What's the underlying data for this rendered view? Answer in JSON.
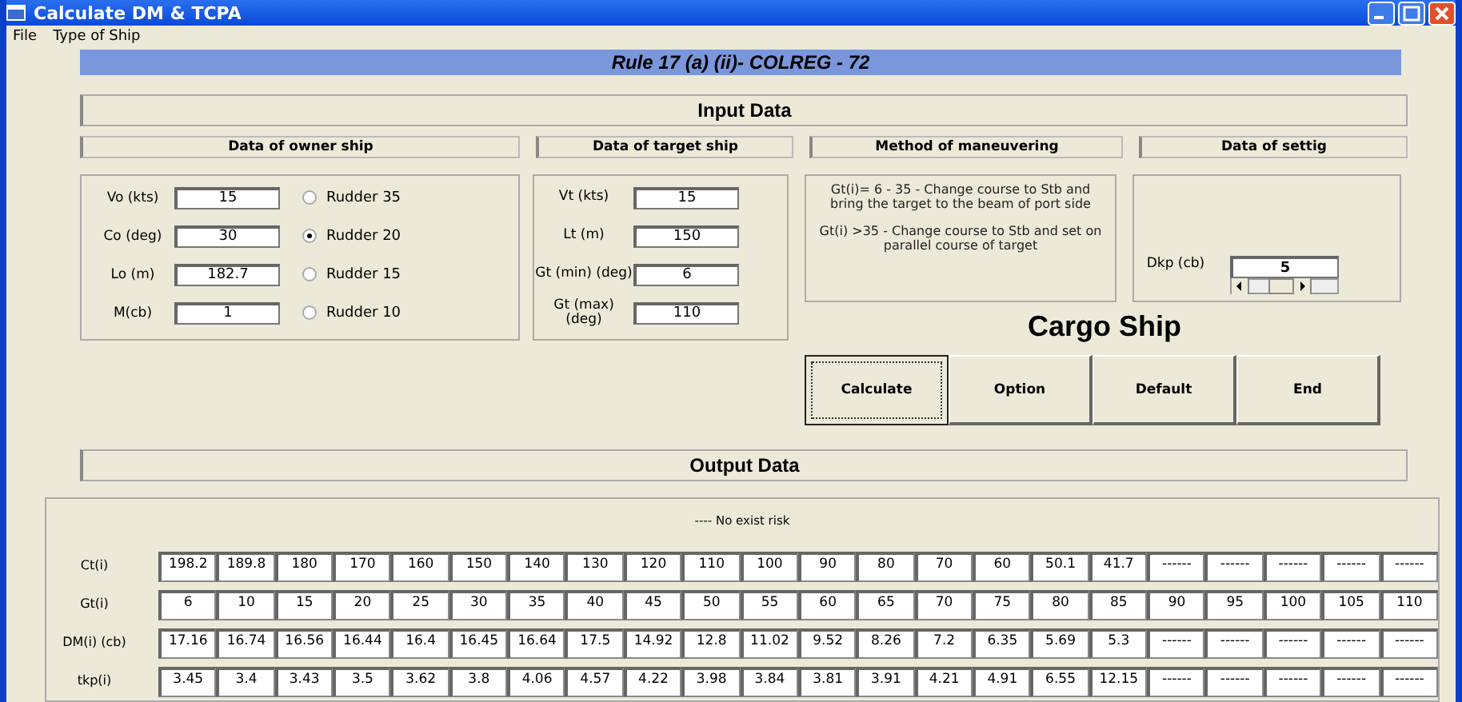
{
  "window": {
    "title": "Calculate DM & TCPA"
  },
  "menu": [
    "File",
    "Type of Ship"
  ],
  "banner": "Rule 17 (a) (ii)- COLREG - 72",
  "input_title": "Input Data",
  "section_headers": [
    "Data of owner ship",
    "Data of target ship",
    "Method of maneuvering",
    "Data of settig"
  ],
  "owner_fields": [
    {
      "label": "Vo (kts)",
      "value": "15"
    },
    {
      "label": "Co (deg)",
      "value": "30"
    },
    {
      "label": "Lo (m)",
      "value": "182.7"
    },
    {
      "label": "M(cb)",
      "value": "1"
    }
  ],
  "rudder_options": [
    {
      "label": "Rudder 35",
      "selected": false
    },
    {
      "label": "Rudder 20",
      "selected": true
    },
    {
      "label": "Rudder 15",
      "selected": false
    },
    {
      "label": "Rudder 10",
      "selected": false
    }
  ],
  "target_fields": [
    {
      "label": "Vt (kts)",
      "value": "15"
    },
    {
      "label": "Lt (m)",
      "value": "150"
    },
    {
      "label": "Gt (min) (deg)",
      "value": "6"
    },
    {
      "label": "Gt (max) (deg)",
      "value": "110"
    }
  ],
  "method_text": [
    "Gt(i)= 6 - 35 - Change course to Stb and bring the target to the beam of port side",
    "Gt(i) >35 - Change course to Stb and set on parallel course of target"
  ],
  "setting": {
    "label": "Dkp (cb)",
    "value": "5"
  },
  "ship_type": "Cargo Ship",
  "buttons": [
    {
      "label": "Calculate",
      "focused": true
    },
    {
      "label": "Option",
      "focused": false
    },
    {
      "label": "Default",
      "focused": false
    },
    {
      "label": "End",
      "focused": false
    }
  ],
  "output_title": "Output Data",
  "status_note": "---- No exist risk",
  "output_rows": [
    {
      "label": "Ct(i)",
      "cells": [
        "198.2",
        "189.8",
        "180",
        "170",
        "160",
        "150",
        "140",
        "130",
        "120",
        "110",
        "100",
        "90",
        "80",
        "70",
        "60",
        "50.1",
        "41.7",
        "------",
        "------",
        "------",
        "------",
        "------"
      ]
    },
    {
      "label": "Gt(i)",
      "cells": [
        "6",
        "10",
        "15",
        "20",
        "25",
        "30",
        "35",
        "40",
        "45",
        "50",
        "55",
        "60",
        "65",
        "70",
        "75",
        "80",
        "85",
        "90",
        "95",
        "100",
        "105",
        "110"
      ]
    },
    {
      "label": "DM(i) (cb)",
      "cells": [
        "17.16",
        "16.74",
        "16.56",
        "16.44",
        "16.4",
        "16.45",
        "16.64",
        "17.5",
        "14.92",
        "12.8",
        "11.02",
        "9.52",
        "8.26",
        "7.2",
        "6.35",
        "5.69",
        "5.3",
        "------",
        "------",
        "------",
        "------",
        "------"
      ]
    },
    {
      "label": "tkp(i)",
      "cells": [
        "3.45",
        "3.4",
        "3.43",
        "3.5",
        "3.62",
        "3.8",
        "4.06",
        "4.57",
        "4.22",
        "3.98",
        "3.84",
        "3.81",
        "3.91",
        "4.21",
        "4.91",
        "6.55",
        "12.15",
        "------",
        "------",
        "------",
        "------",
        "------"
      ]
    }
  ]
}
